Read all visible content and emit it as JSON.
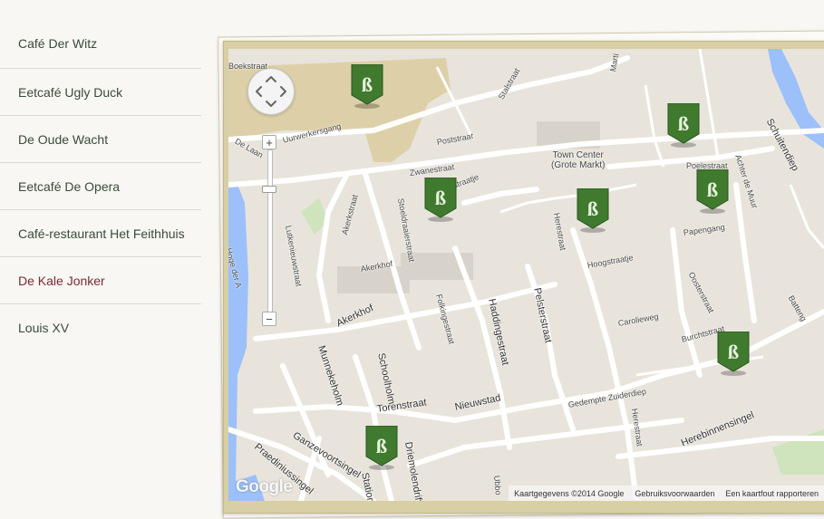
{
  "sidebar": {
    "items": [
      {
        "label": "Café Der Witz",
        "active": false
      },
      {
        "label": "Eetcafé Ugly Duck",
        "active": false
      },
      {
        "label": "De Oude Wacht",
        "active": false
      },
      {
        "label": "Eetcafé De Opera",
        "active": false
      },
      {
        "label": "Café-restaurant Het Feithhuis",
        "active": false
      },
      {
        "label": "De Kale Jonker",
        "active": true
      },
      {
        "label": "Louis XV",
        "active": false
      }
    ]
  },
  "map": {
    "center_label_line1": "Town Center",
    "center_label_line2": "(Grote Markt)",
    "streets": {
      "boekstraat": "Boekstraat",
      "uurwerkersgang": "Uurwerkersgang",
      "de_laan": "De Laan",
      "hoge_der_a": "Hoge der A",
      "lutkenieuwstraat": "Lutkenieuwstraat",
      "akerkstraat": "Akerkstraat",
      "akerkhof": "Akerkhof",
      "akerkhof2": "Akerkhof",
      "zwanestraat": "Zwanestraat",
      "straatje": "straatje",
      "poststraat": "Poststraat",
      "stalstraat": "Stalstraat",
      "martini": "Marti",
      "stoeldraaierstraat": "Stoeldraaierstraat",
      "folkingestraat": "Folkingestraat",
      "haddingestraat": "Haddingestraat",
      "pelsterstraat": "Pelsterstraat",
      "herestraat": "Herestraat",
      "herestraat2": "Herestraat",
      "hoogstraatje": "Hoogstraatje",
      "poelestraat": "Poelestraat",
      "papengang": "Papengang",
      "achter_de_muur": "Achter de Muur",
      "schuitendiep": "Schuitendiep",
      "oosterstraat": "Oosterstraat",
      "carolieweg": "Carolieweg",
      "burchtstraat": "Burchtstraat",
      "battengang": "Batteng",
      "gedempte_zuiderdiep": "Gedempte Zuiderdiep",
      "herebinnensingel": "Herebinnensingel",
      "munnekeholm": "Munnekeholm",
      "schoolholm": "Schoolholm",
      "torenstraat": "Torenstraat",
      "nieuwstad": "Nieuwstad",
      "ganzevoortsingel": "Ganzevoortsingel",
      "praediniussingel": "Praediniussingel",
      "driemolendrift": "Driemolendrift",
      "station": "Station",
      "ubbo": "Ubbo"
    },
    "markers": [
      {
        "name": "marker-1"
      },
      {
        "name": "marker-2"
      },
      {
        "name": "marker-3"
      },
      {
        "name": "marker-4"
      },
      {
        "name": "marker-5"
      },
      {
        "name": "marker-6"
      },
      {
        "name": "marker-7"
      }
    ],
    "controls": {
      "zoom_in": "+",
      "zoom_out": "−"
    },
    "logo": "Google",
    "attribution": {
      "copyright": "Kaartgegevens ©2014 Google",
      "terms": "Gebruiksvoorwaarden",
      "report": "Een kaartfout rapporteren"
    },
    "colors": {
      "marker_green": "#3f7a2e",
      "water": "#9cc0f9",
      "road": "#ffffff",
      "land": "#e8e4dc",
      "frame": "#d8cfa4",
      "active_item": "#7a2a35"
    }
  }
}
